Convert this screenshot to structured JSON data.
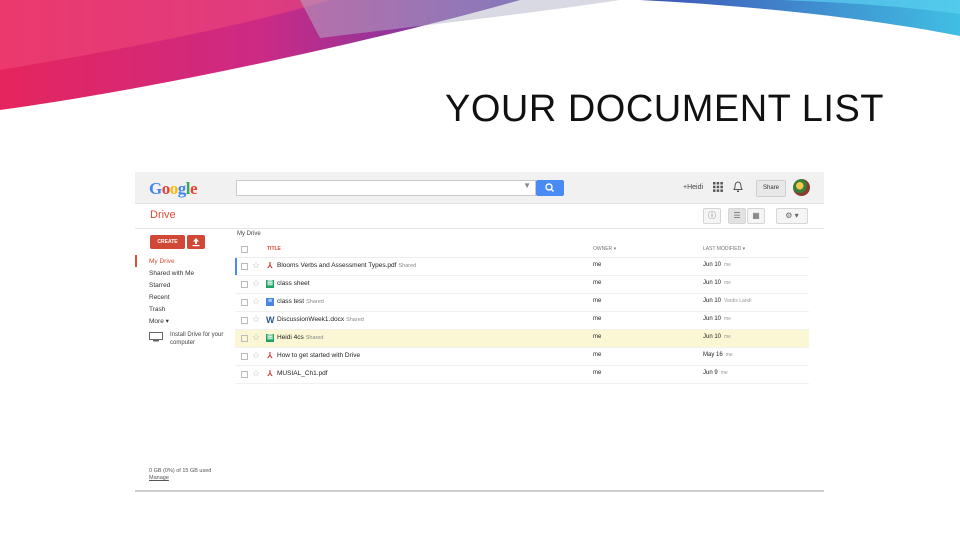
{
  "slide_title": "YOUR DOCUMENT LIST",
  "colors": {
    "accent_red": "#dd4b39",
    "accent_blue": "#4a8af4",
    "selected_row": "#fbf7d5"
  },
  "header": {
    "logo": "Google",
    "search_placeholder": "",
    "username": "+Heidi",
    "share_label": "Share"
  },
  "toolbar": {
    "app_name": "Drive",
    "settings_icon": "gear-icon",
    "view_icons": [
      "list-view-icon",
      "grid-view-icon"
    ]
  },
  "sidebar": {
    "create_label": "CREATE",
    "items": [
      "My Drive",
      "Shared with Me",
      "Starred",
      "Recent",
      "Trash",
      "More ▾"
    ],
    "install_text": "Install Drive for your computer",
    "storage_text": "0 GB (0%) of 15 GB used",
    "manage_label": "Manage"
  },
  "list": {
    "breadcrumb": "My Drive",
    "headers": {
      "title": "TITLE",
      "owner": "OWNER",
      "modified": "LAST MODIFIED"
    },
    "rows": [
      {
        "icon": "pdf",
        "title": "Blooms Verbs and Assessment Types.pdf",
        "shared": "Shared",
        "owner": "me",
        "date": "Jun 10",
        "by": "me"
      },
      {
        "icon": "sheet",
        "title": "class sheet",
        "shared": "",
        "owner": "me",
        "date": "Jun 10",
        "by": "me"
      },
      {
        "icon": "doc",
        "title": "class test",
        "shared": "Shared",
        "owner": "me",
        "date": "Jun 10",
        "by": "Vardis Landi"
      },
      {
        "icon": "word",
        "title": "DiscussionWeek1.docx",
        "shared": "Shared",
        "owner": "me",
        "date": "Jun 10",
        "by": "me"
      },
      {
        "icon": "sheet",
        "title": "Heidi 4cs",
        "shared": "Shared",
        "owner": "me",
        "date": "Jun 10",
        "by": "me"
      },
      {
        "icon": "pdf",
        "title": "How to get started with Drive",
        "shared": "",
        "owner": "me",
        "date": "May 16",
        "by": "me"
      },
      {
        "icon": "pdf",
        "title": "MUSIAL_Ch1.pdf",
        "shared": "",
        "owner": "me",
        "date": "Jun 9",
        "by": "me"
      }
    ]
  }
}
